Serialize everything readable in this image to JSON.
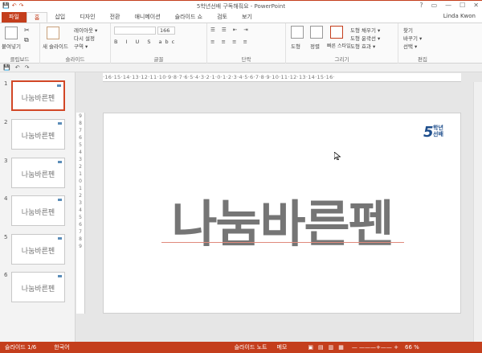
{
  "window": {
    "title": "5학년선배 구독해줘요 - PowerPoint",
    "user": "Linda Kwon"
  },
  "qat": {
    "save": "💾",
    "undo": "↶",
    "redo": "↷"
  },
  "winbtns": [
    "?",
    "▭",
    "—",
    "☐",
    "✕"
  ],
  "tabs": [
    "파일",
    "홈",
    "삽입",
    "디자인",
    "전환",
    "애니메이션",
    "슬라이드 쇼",
    "검토",
    "보기"
  ],
  "ribbon": {
    "clipboard": {
      "label": "클립보드",
      "paste": "붙여넣기"
    },
    "slides": {
      "label": "슬라이드",
      "new_slide": "새 슬라이드",
      "layout": "레이아웃 ▾",
      "reset": "다시 설정",
      "section": "구역 ▾"
    },
    "font": {
      "label": "글꼴",
      "size": "166"
    },
    "paragraph": {
      "label": "단락"
    },
    "drawing": {
      "label": "그리기",
      "shapes": "도형",
      "arrange": "정렬",
      "quick_styles": "빠른 스타일",
      "fill": "도형 채우기 ▾",
      "outline": "도형 윤곽선 ▾",
      "effects": "도형 효과 ▾"
    },
    "editing": {
      "label": "편집",
      "find": "찾기",
      "replace": "바꾸기 ▾",
      "select": "선택 ▾"
    }
  },
  "ruler": {
    "horizontal": "·16·15·14·13·12·11·10·9·8·7·6·5·4·3·2·1·0·1·2·3·4·5·6·7·8·9·10·11·12·13·14·15·16·",
    "vertical": [
      "9",
      "8",
      "7",
      "6",
      "5",
      "4",
      "3",
      "2",
      "1",
      "0",
      "1",
      "2",
      "3",
      "4",
      "5",
      "6",
      "7",
      "8",
      "9"
    ]
  },
  "thumbnails": [
    {
      "num": "1",
      "text": "나눔바른펜"
    },
    {
      "num": "2",
      "text": "나눔바른펜"
    },
    {
      "num": "3",
      "text": "나눔바른펜"
    },
    {
      "num": "4",
      "text": "나눔바른펜"
    },
    {
      "num": "5",
      "text": "나눔바른펜"
    },
    {
      "num": "6",
      "text": "나눔바른펜"
    }
  ],
  "slide": {
    "main_text": "나눔바른펜",
    "logo_number": "5",
    "logo_line1": "학년",
    "logo_line2": "선배"
  },
  "status": {
    "slide_info": "슬라이드 1/6",
    "language": "한국어",
    "notes": "슬라이드 노트",
    "comments": "메모",
    "zoom": "66 %"
  },
  "colors": {
    "accent": "#c43e1c",
    "logo": "#1e4e8c"
  }
}
